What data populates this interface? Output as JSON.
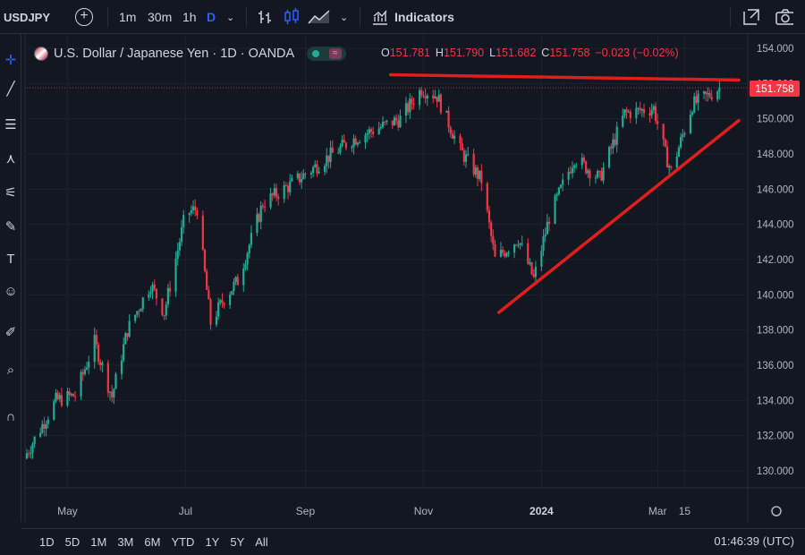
{
  "toolbar": {
    "symbol": "USDJPY",
    "add_icon": "plus-circle-icon",
    "intervals": [
      "1m",
      "30m",
      "1h",
      "D"
    ],
    "active_interval": "D",
    "indicators_label": "Indicators"
  },
  "legend": {
    "title": "U.S. Dollar / Japanese Yen · 1D · OANDA",
    "ohlc": [
      {
        "k": "O",
        "v": "151.781"
      },
      {
        "k": "H",
        "v": "151.790"
      },
      {
        "k": "L",
        "v": "151.682"
      },
      {
        "k": "C",
        "v": "151.758"
      }
    ],
    "change": "−0.023 (−0.02%)"
  },
  "price_tag": "151.758",
  "bottombar": {
    "ranges": [
      "1D",
      "5D",
      "1M",
      "3M",
      "6M",
      "YTD",
      "1Y",
      "5Y",
      "All"
    ],
    "clock": "01:46:39 (UTC)"
  },
  "colors": {
    "background": "#131722",
    "up": "#22ab94",
    "down": "#f23645",
    "annotation": "#e01e1e",
    "grid": "#1e222d"
  },
  "chart_data": {
    "type": "candlestick",
    "title": "U.S. Dollar / Japanese Yen · 1D · OANDA",
    "ylim": [
      129.0,
      154.8
    ],
    "yticks": [
      "130.000",
      "132.000",
      "134.000",
      "136.000",
      "138.000",
      "140.000",
      "142.000",
      "144.000",
      "146.000",
      "148.000",
      "150.000",
      "152.000",
      "154.000"
    ],
    "xticks": [
      "May",
      "Jul",
      "Sep",
      "Nov",
      "2024",
      "Mar",
      "15"
    ],
    "last_price": 151.758,
    "series": [
      {
        "date": "2023-04-10",
        "close": 131.0
      },
      {
        "date": "2023-04-25",
        "close": 134.0
      },
      {
        "date": "2023-05-05",
        "close": 134.3
      },
      {
        "date": "2023-05-15",
        "close": 137.3
      },
      {
        "date": "2023-05-24",
        "close": 134.2
      },
      {
        "date": "2023-06-01",
        "close": 138.0
      },
      {
        "date": "2023-06-13",
        "close": 140.6
      },
      {
        "date": "2023-06-20",
        "close": 139.0
      },
      {
        "date": "2023-07-01",
        "close": 144.6
      },
      {
        "date": "2023-07-07",
        "close": 144.9
      },
      {
        "date": "2023-07-14",
        "close": 138.4
      },
      {
        "date": "2023-07-21",
        "close": 139.8
      },
      {
        "date": "2023-07-28",
        "close": 140.8
      },
      {
        "date": "2023-08-10",
        "close": 145.2
      },
      {
        "date": "2023-08-25",
        "close": 146.3
      },
      {
        "date": "2023-09-10",
        "close": 147.6
      },
      {
        "date": "2023-09-25",
        "close": 148.8
      },
      {
        "date": "2023-10-05",
        "close": 149.3
      },
      {
        "date": "2023-10-20",
        "close": 150.0
      },
      {
        "date": "2023-10-31",
        "close": 151.7
      },
      {
        "date": "2023-11-08",
        "close": 151.3
      },
      {
        "date": "2023-11-20",
        "close": 148.2
      },
      {
        "date": "2023-12-01",
        "close": 146.5
      },
      {
        "date": "2023-12-08",
        "close": 142.0
      },
      {
        "date": "2023-12-20",
        "close": 143.2
      },
      {
        "date": "2023-12-28",
        "close": 140.9
      },
      {
        "date": "2024-01-05",
        "close": 144.4
      },
      {
        "date": "2024-01-18",
        "close": 147.8
      },
      {
        "date": "2024-01-31",
        "close": 146.6
      },
      {
        "date": "2024-02-13",
        "close": 150.3
      },
      {
        "date": "2024-02-28",
        "close": 150.6
      },
      {
        "date": "2024-03-05",
        "close": 148.0
      },
      {
        "date": "2024-03-08",
        "close": 147.0
      },
      {
        "date": "2024-03-19",
        "close": 150.8
      },
      {
        "date": "2024-03-27",
        "close": 151.3
      },
      {
        "date": "2024-04-02",
        "close": 151.758
      }
    ],
    "annotations": [
      {
        "type": "horizontal-resistance-line",
        "from": {
          "date": "2023-10-15",
          "price": 152.5
        },
        "to": {
          "date": "2024-04-12",
          "price": 152.2
        }
      },
      {
        "type": "ascending-support-line",
        "from": {
          "date": "2023-12-10",
          "price": 139.0
        },
        "to": {
          "date": "2024-04-12",
          "price": 149.9
        }
      }
    ]
  }
}
